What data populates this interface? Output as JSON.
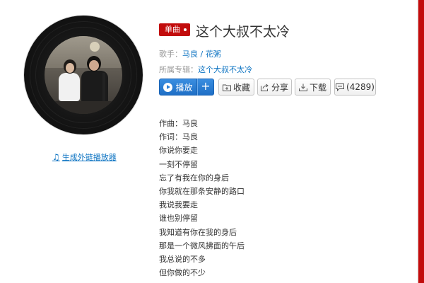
{
  "colors": {
    "accent": "#c20c0c",
    "link": "#0c73c2",
    "primary_button": "#2a7fd6"
  },
  "disc": {
    "cover_alt": "two singers performing in a studio"
  },
  "player_link": {
    "icon": "music-note-icon",
    "label": "生成外链播放器"
  },
  "song": {
    "type_badge": "单曲",
    "title": "这个大叔不太冷"
  },
  "singer": {
    "label": "歌手：",
    "name1": "马良",
    "sep": " / ",
    "name2": "花粥"
  },
  "album": {
    "label": "所属专辑：",
    "name": "这个大叔不太冷"
  },
  "actions": {
    "play": {
      "icon": "play-icon",
      "label": "播放"
    },
    "add": {
      "icon": "plus-icon",
      "label": "+"
    },
    "favorite": {
      "icon": "folder-plus-icon",
      "label": "收藏"
    },
    "share": {
      "icon": "share-icon",
      "label": "分享"
    },
    "download": {
      "icon": "download-icon",
      "label": "下载"
    },
    "comment": {
      "icon": "comment-icon",
      "label": "(4289)"
    }
  },
  "lyrics": [
    "作曲：马良",
    "作词：马良",
    "你说你要走",
    "一刻不停留",
    "忘了有我在你的身后",
    "你我就在那条安静的路口",
    "我说我要走",
    "谁也别停留",
    "我知道有你在我的身后",
    "那是一个微风拂面的午后",
    "我总说的不多",
    "但你做的不少"
  ]
}
